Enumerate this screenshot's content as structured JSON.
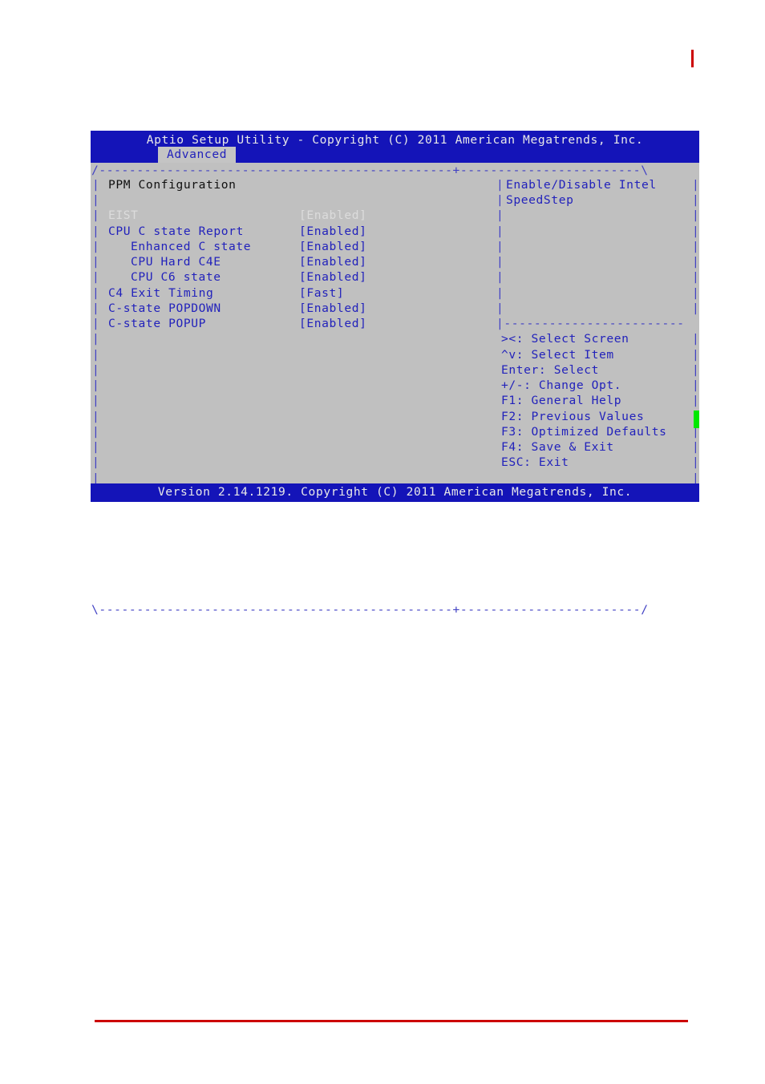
{
  "document": {
    "top_marker_color": "#cc0000",
    "bottom_rule_color": "#cc0000"
  },
  "bios": {
    "title": "Aptio Setup Utility - Copyright (C) 2011 American Megatrends, Inc.",
    "active_tab": "Advanced",
    "footer": "Version 2.14.1219. Copyright (C) 2011 American Megatrends, Inc.",
    "section_heading": "PPM Configuration",
    "rule_top": "/-----------------------------------------------+------------------------\\",
    "rule_bottom": "\\-----------------------------------------------+------------------------/",
    "panel_divider": "|------------------------",
    "pipe": "|",
    "settings": [
      {
        "label": "EIST",
        "value": "[Enabled]",
        "indent": 0,
        "state": "selected"
      },
      {
        "label": "CPU C state Report",
        "value": "[Enabled]",
        "indent": 0,
        "state": "normal"
      },
      {
        "label": "Enhanced C state",
        "value": "[Enabled]",
        "indent": 1,
        "state": "normal"
      },
      {
        "label": "CPU Hard C4E",
        "value": "[Enabled]",
        "indent": 1,
        "state": "normal"
      },
      {
        "label": "CPU C6 state",
        "value": "[Enabled]",
        "indent": 1,
        "state": "normal"
      },
      {
        "label": "C4 Exit Timing",
        "value": "[Fast]",
        "indent": 0,
        "state": "normal"
      },
      {
        "label": "C-state POPDOWN",
        "value": "[Enabled]",
        "indent": 0,
        "state": "normal"
      },
      {
        "label": "C-state POPUP",
        "value": "[Enabled]",
        "indent": 0,
        "state": "normal"
      }
    ],
    "help_text": [
      "Enable/Disable Intel",
      "SpeedStep"
    ],
    "key_legend": [
      "><: Select Screen",
      "^v: Select Item",
      "Enter: Select",
      "+/-: Change Opt.",
      "F1: General Help",
      "F2: Previous Values",
      "F3: Optimized Defaults",
      "F4: Save & Exit",
      "ESC: Exit"
    ],
    "scroll_marker_color": "#00e800"
  }
}
